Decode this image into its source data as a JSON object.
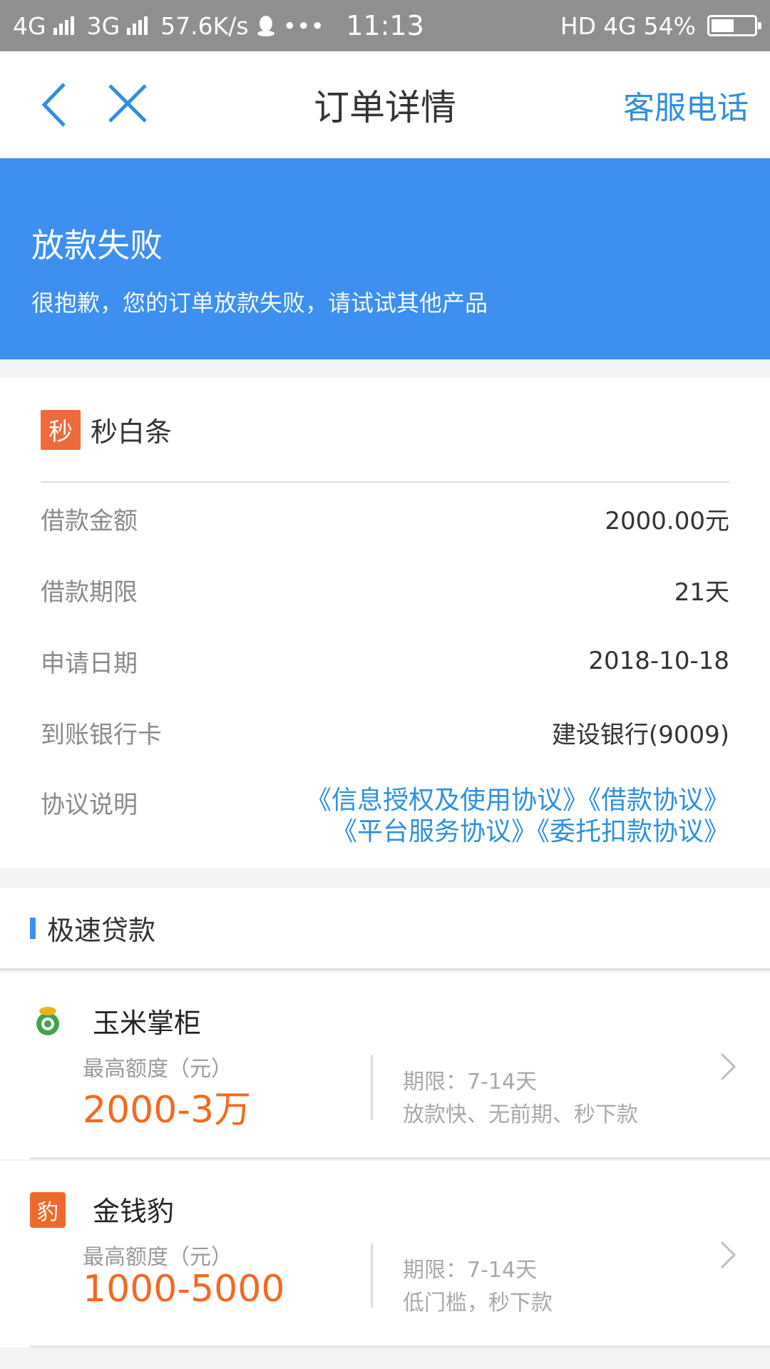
{
  "status_bar": {
    "net1": "4G",
    "net2": "3G",
    "speed": "57.6K/s",
    "more": "•••",
    "time": "11:13",
    "hd": "HD",
    "net3": "4G",
    "battery": "54%",
    "battery_level": 0.54
  },
  "nav": {
    "title": "订单详情",
    "service": "客服电话",
    "back_icon": "chevron-left-icon",
    "close_icon": "close-icon"
  },
  "banner": {
    "title": "放款失败",
    "subtitle": "很抱歉，您的订单放款失败，请试试其他产品",
    "color": "#3d8ff0"
  },
  "order": {
    "product_logo": "秒",
    "product_name": "秒白条",
    "rows": [
      {
        "label": "借款金额",
        "value": "2000.00元"
      },
      {
        "label": "借款期限",
        "value": "21天"
      },
      {
        "label": "申请日期",
        "value": "2018-10-18"
      },
      {
        "label": "到账银行卡",
        "value": "建设银行(9009)"
      }
    ],
    "agreement_label": "协议说明",
    "agreements": [
      "《信息授权及使用协议》",
      "《借款协议》",
      "《平台服务协议》",
      "《委托扣款协议》"
    ]
  },
  "fast_loan": {
    "title": "极速贷款",
    "items": [
      {
        "logo": "corn-logo-icon",
        "name": "玉米掌柜",
        "caption": "最高额度（元）",
        "amount": "2000-3万",
        "term": "期限：7-14天",
        "desc": "放款快、无前期、秒下款"
      },
      {
        "logo": "豹",
        "name": "金钱豹",
        "caption": "最高额度（元）",
        "amount": "1000-5000",
        "term": "期限：7-14天",
        "desc": "低门槛，秒下款"
      }
    ]
  },
  "colors": {
    "accent": "#3d8ff0",
    "link": "#2f8fdd",
    "amount": "#f26a20",
    "logo_orange": "#ef6a3b"
  }
}
